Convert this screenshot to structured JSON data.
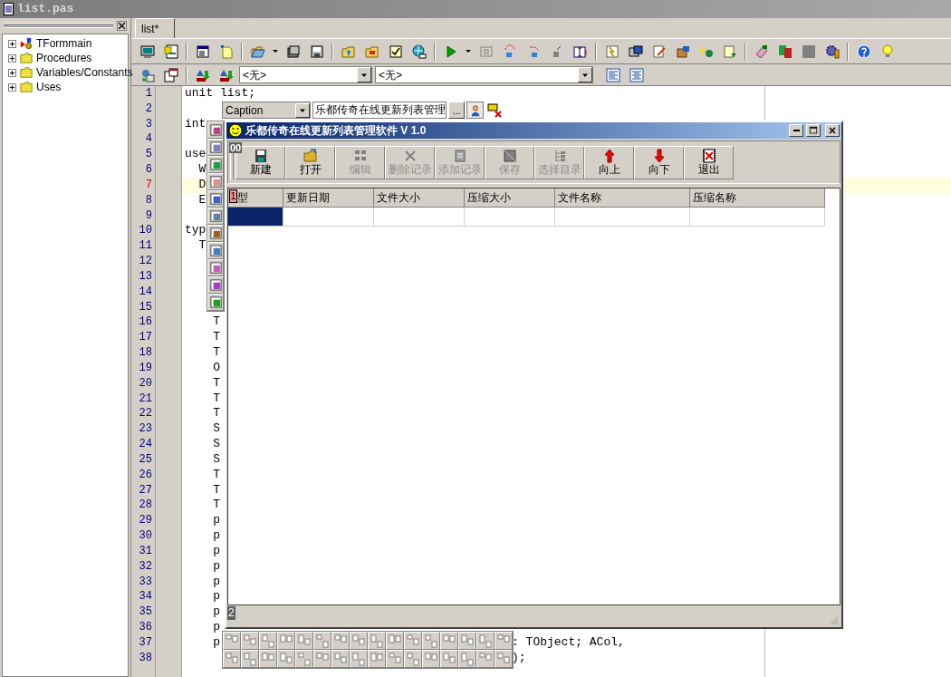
{
  "window": {
    "title": "list.pas"
  },
  "tree": [
    {
      "label": "TFormmain",
      "kind": "component",
      "expanded": false
    },
    {
      "label": "Procedures",
      "kind": "folder",
      "expanded": false
    },
    {
      "label": "Variables/Constants",
      "kind": "folder",
      "expanded": false
    },
    {
      "label": "Uses",
      "kind": "folder",
      "expanded": false
    }
  ],
  "tabs": [
    {
      "label": "list*",
      "selected": true
    }
  ],
  "combos": [
    {
      "value": "<无>"
    },
    {
      "value": "<无>"
    }
  ],
  "editor": {
    "lines": [
      {
        "number": "1",
        "text": "unit list;",
        "current": false
      },
      {
        "number": "2",
        "current": false
      },
      {
        "number": "3",
        "text": "int",
        "current": false
      },
      {
        "number": "4",
        "current": false
      },
      {
        "number": "5",
        "text": "use",
        "current": false
      },
      {
        "number": "6",
        "text": "  W",
        "current": false
      },
      {
        "number": "7",
        "text": "  D",
        "current": true
      },
      {
        "number": "8",
        "text": "  E",
        "current": false
      },
      {
        "number": "9",
        "current": false
      },
      {
        "number": "10",
        "text": "typ",
        "current": false
      },
      {
        "number": "11",
        "text": "  T",
        "current": false
      },
      {
        "number": "12",
        "current": false
      },
      {
        "number": "13",
        "current": false
      },
      {
        "number": "14",
        "current": false
      },
      {
        "number": "15",
        "current": false
      },
      {
        "number": "16",
        "text": "    T",
        "current": false
      },
      {
        "number": "17",
        "text": "    T",
        "current": false
      },
      {
        "number": "18",
        "text": "    T",
        "current": false
      },
      {
        "number": "19",
        "text": "    O",
        "current": false
      },
      {
        "number": "20",
        "text": "    T",
        "current": false
      },
      {
        "number": "21",
        "text": "    T",
        "current": false
      },
      {
        "number": "22",
        "text": "    T",
        "current": false
      },
      {
        "number": "23",
        "text": "    S",
        "current": false
      },
      {
        "number": "24",
        "text": "    S",
        "current": false
      },
      {
        "number": "25",
        "text": "    S",
        "current": false
      },
      {
        "number": "26",
        "text": "    T",
        "current": false
      },
      {
        "number": "27",
        "text": "    T",
        "current": false
      },
      {
        "number": "28",
        "text": "    T",
        "current": false
      },
      {
        "number": "29",
        "text": "    p",
        "current": false
      },
      {
        "number": "30",
        "text": "    p",
        "current": false
      },
      {
        "number": "31",
        "text": "    p",
        "current": false
      },
      {
        "number": "32",
        "text": "    p",
        "current": false
      },
      {
        "number": "33",
        "text": "    p",
        "current": false
      },
      {
        "number": "34",
        "text": "    p",
        "current": false
      },
      {
        "number": "35",
        "text": "    p",
        "current": false
      },
      {
        "number": "36",
        "text": "    p",
        "current": false
      },
      {
        "number": "37",
        "text": "    p",
        "tail": ": TObject; ACol,",
        "current": false
      },
      {
        "number": "38",
        "tail": ");",
        "current": false
      }
    ]
  },
  "property_bar": {
    "property": "Caption",
    "value": "乐都传奇在线更新列表管理",
    "ellipsis": "..."
  },
  "form": {
    "title": "乐都传奇在线更新列表管理软件 V 1.0",
    "toolbar_badge": "00",
    "buttons": [
      {
        "label": "新建",
        "disabled": false
      },
      {
        "label": "打开",
        "disabled": false
      },
      {
        "label": "编辑",
        "disabled": true
      },
      {
        "label": "删除记录",
        "disabled": true
      },
      {
        "label": "添加记录",
        "disabled": true
      },
      {
        "label": "保存",
        "disabled": true
      },
      {
        "label": "选择目录",
        "disabled": true
      },
      {
        "label": "向上",
        "disabled": false
      },
      {
        "label": "向下",
        "disabled": false
      },
      {
        "label": "退出",
        "disabled": false
      }
    ],
    "grid": {
      "badge": "1",
      "columns": [
        "型",
        "更新日期",
        "文件大小",
        "压缩大小",
        "文件名称",
        "压缩名称"
      ],
      "rows": [
        {
          "cells": [
            {
              "selected": true
            },
            {
              "selected": false
            },
            {
              "selected": false
            },
            {
              "selected": false
            },
            {
              "selected": false
            },
            {
              "selected": false
            }
          ]
        }
      ]
    },
    "status_badge": "2"
  }
}
